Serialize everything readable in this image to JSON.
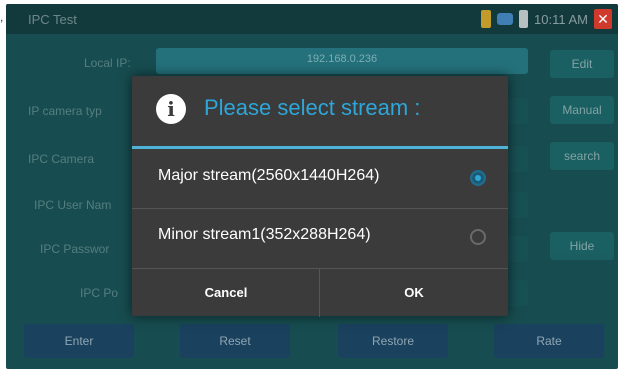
{
  "corner_mark": ",",
  "app": {
    "title": "IPC Test",
    "clock": "10:11 AM",
    "close_glyph": "✕"
  },
  "background": {
    "labels": [
      "Local IP:",
      "IP camera typ",
      "IPC Camera",
      "IPC User Nam",
      "IPC Passwor",
      "IPC Po"
    ],
    "ip_value": "192.168.0.236",
    "side_buttons": [
      "Edit",
      "Manual",
      "search",
      "Hide"
    ],
    "bottom_buttons": [
      "Enter",
      "Reset",
      "Restore",
      "Rate"
    ]
  },
  "dialog": {
    "info_glyph": "i",
    "title": "Please select stream :",
    "options": [
      {
        "label": "Major stream(2560x1440H264)",
        "selected": true
      },
      {
        "label": "Minor stream1(352x288H264)",
        "selected": false
      }
    ],
    "cancel_label": "Cancel",
    "ok_label": "OK"
  },
  "colors": {
    "accent": "#2ea6d8",
    "dialog_bg": "#3b3b3b",
    "screen_bg": "#174d50"
  }
}
